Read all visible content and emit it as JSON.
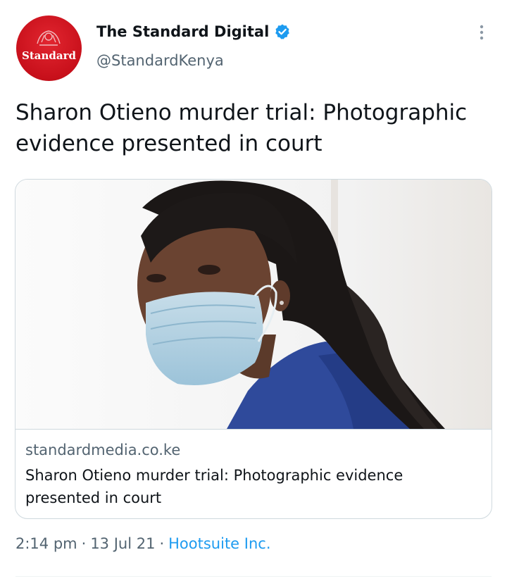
{
  "author": {
    "display_name": "The Standard Digital",
    "handle": "@StandardKenya",
    "avatar_label": "Standard",
    "verified": true,
    "avatar_color": "#c8101b"
  },
  "tweet": {
    "text": "Sharon Otieno murder trial: Photographic evidence presented in court"
  },
  "card": {
    "domain": "standardmedia.co.ke",
    "title": "Sharon Otieno murder trial: Photographic evidence presented in court"
  },
  "meta": {
    "time": "2:14 pm",
    "date": "13 Jul 21",
    "source": "Hootsuite Inc.",
    "separator": "·"
  },
  "icons": {
    "verified": "verified-badge-icon",
    "more": "more-options-icon"
  },
  "colors": {
    "link": "#1d9bf0",
    "secondary_text": "#536471",
    "primary_text": "#0f1419",
    "border": "#cfd9de"
  }
}
